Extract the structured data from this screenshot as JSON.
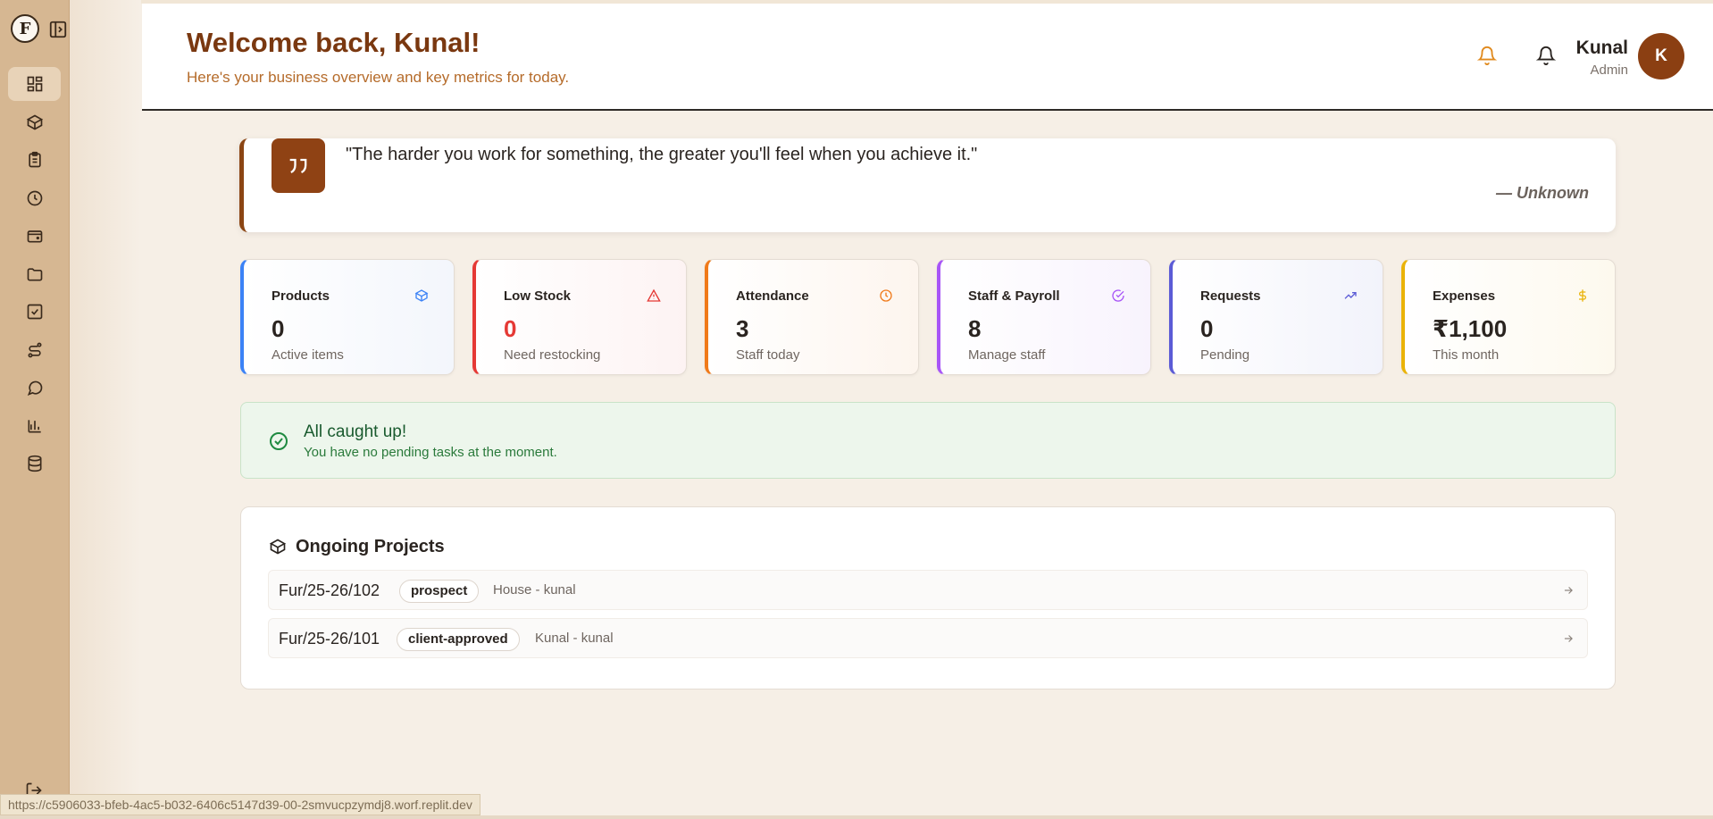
{
  "header": {
    "title": "Welcome back, Kunal!",
    "subtitle": "Here's your business overview and key metrics for today.",
    "user_name": "Kunal",
    "user_role": "Admin",
    "avatar_initial": "K"
  },
  "sidebar": {
    "logo": "F",
    "items": [
      {
        "icon": "dashboard-icon"
      },
      {
        "icon": "box-icon"
      },
      {
        "icon": "clipboard-icon"
      },
      {
        "icon": "clock-icon"
      },
      {
        "icon": "wallet-icon"
      },
      {
        "icon": "folder-icon"
      },
      {
        "icon": "check-square-icon"
      },
      {
        "icon": "route-icon"
      },
      {
        "icon": "chat-icon"
      },
      {
        "icon": "bar-chart-icon"
      },
      {
        "icon": "database-icon"
      }
    ]
  },
  "quote": {
    "text": "\"The harder you work for something, the greater you'll feel when you achieve it.\"",
    "author": "— Unknown"
  },
  "stats": [
    {
      "label": "Products",
      "value": "0",
      "sub": "Active items",
      "color": "#3b82f6",
      "icon": "box-icon"
    },
    {
      "label": "Low Stock",
      "value": "0",
      "sub": "Need restocking",
      "color": "#e53935",
      "icon": "warning-icon"
    },
    {
      "label": "Attendance",
      "value": "3",
      "sub": "Staff today",
      "color": "#f07a1a",
      "icon": "clock-icon"
    },
    {
      "label": "Staff & Payroll",
      "value": "8",
      "sub": "Manage staff",
      "color": "#a855f7",
      "icon": "check-circle-icon"
    },
    {
      "label": "Requests",
      "value": "0",
      "sub": "Pending",
      "color": "#5b5bd6",
      "icon": "trending-up-icon"
    },
    {
      "label": "Expenses",
      "value": "₹1,100",
      "sub": "This month",
      "color": "#eab308",
      "icon": "dollar-icon"
    }
  ],
  "caught_up": {
    "title": "All caught up!",
    "subtitle": "You have no pending tasks at the moment."
  },
  "projects": {
    "title": "Ongoing Projects",
    "rows": [
      {
        "code": "Fur/25-26/102",
        "status": "prospect",
        "client": "House - kunal"
      },
      {
        "code": "Fur/25-26/101",
        "status": "client-approved",
        "client": "Kunal - kunal"
      }
    ]
  },
  "status_url": "https://c5906033-bfeb-4ac5-b032-6406c5147d39-00-2smvucpzymdj8.worf.replit.dev"
}
